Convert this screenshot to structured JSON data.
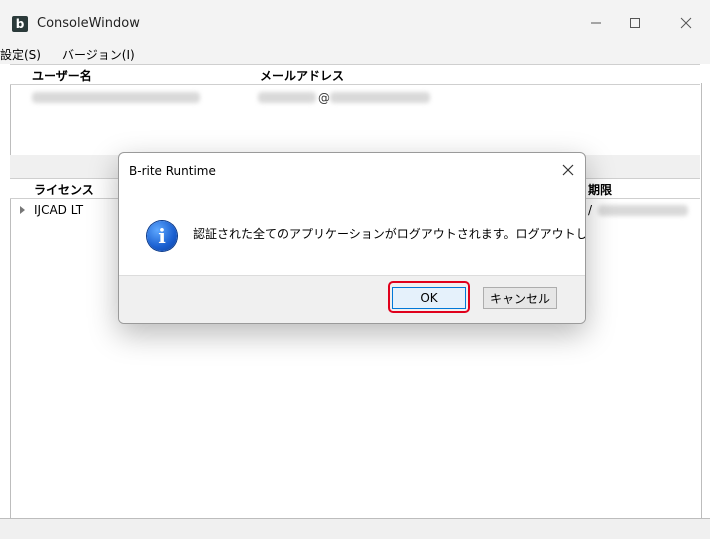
{
  "window": {
    "app_icon_letter": "b",
    "title": "ConsoleWindow",
    "controls": [
      "minimize-icon",
      "maximize-icon",
      "close-icon"
    ]
  },
  "menu": {
    "items": [
      {
        "label": "設定(S)"
      },
      {
        "label": "バージョン(I)"
      }
    ]
  },
  "users_table": {
    "columns": [
      "ユーザー名",
      "メールアドレス"
    ],
    "rows": [
      {
        "email_visible_char": "@"
      }
    ]
  },
  "license_table": {
    "columns": [
      "ライセンス",
      "期限"
    ],
    "rows": [
      {
        "name": "IJCAD LT",
        "expiry_partial": "/"
      }
    ]
  },
  "dialog": {
    "title": "B-rite Runtime",
    "icon": "info-icon",
    "icon_glyph": "i",
    "message": "認証された全てのアプリケーションがログアウトされます。ログアウトしますか？",
    "ok_label": "OK",
    "cancel_label": "キャンセル",
    "highlight_color": "#e0001b"
  }
}
